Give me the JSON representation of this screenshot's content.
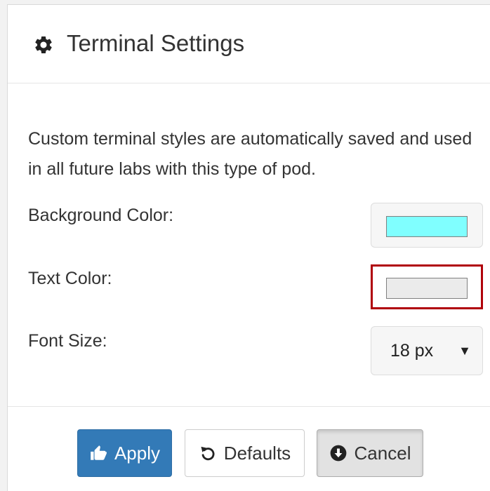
{
  "header": {
    "icon": "gear-icon",
    "title": "Terminal Settings"
  },
  "body": {
    "description": "Custom terminal styles are automatically saved and used in all future labs with this type of pod.",
    "background_color": {
      "label": "Background Color:",
      "value": "#80ffff"
    },
    "text_color": {
      "label": "Text Color:",
      "value": "#ebebeb",
      "focus_border": "#b0000a"
    },
    "font_size": {
      "label": "Font Size:",
      "selected": "18 px",
      "arrow": "▼"
    }
  },
  "footer": {
    "apply": {
      "label": "Apply",
      "icon": "thumbs-up-icon",
      "color": "#337ab7"
    },
    "defaults": {
      "label": "Defaults",
      "icon": "undo-icon"
    },
    "cancel": {
      "label": "Cancel",
      "icon": "circle-arrow-down-icon"
    }
  }
}
